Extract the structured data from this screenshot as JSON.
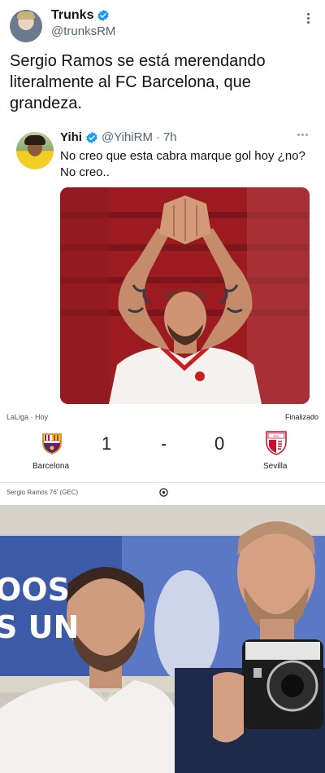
{
  "tweet": {
    "author_name": "Trunks",
    "author_handle": "@trunksRM",
    "text": "Sergio Ramos se está merendando literalmente al FC Barcelona, que grandeza."
  },
  "quoted_tweet": {
    "author_name": "Yihi",
    "author_handle": "@YihiRM",
    "time_sep": "·",
    "time": "7h",
    "text": "No creo que esta cabra marque gol hoy ¿no? No creo.."
  },
  "match": {
    "league": "LaLiga · Hoy",
    "status": "Finalizado",
    "home_team": "Barcelona",
    "away_team": "Sevilla",
    "home_score": "1",
    "separator": "-",
    "away_score": "0",
    "scorer": "Sergio Ramos 76' (GEC)"
  },
  "photo": {
    "banner_line_1": "OOS",
    "banner_line_2": "S UN"
  },
  "colors": {
    "verified": "#1d9bf0",
    "text": "#0f1419",
    "secondary": "#536471"
  }
}
